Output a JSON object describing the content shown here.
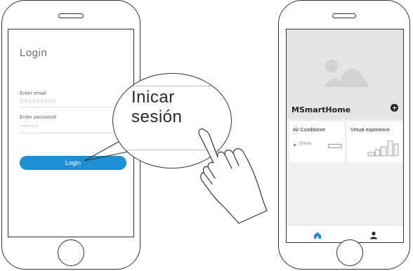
{
  "login_screen": {
    "title": "Login",
    "email_label": "Enter email",
    "email_value": "XXXXXXXXX",
    "password_label": "Enter password",
    "password_value": "••••••••",
    "login_button": "Login"
  },
  "magnifier": {
    "line1": "Inicar",
    "line2": "sesión"
  },
  "home_screen": {
    "app_name": "MSmartHome",
    "devices": [
      {
        "name": "Air Conditioner",
        "status": "Online"
      },
      {
        "name": "Virtual experience"
      }
    ],
    "tabs": [
      "home-icon",
      "user-icon"
    ]
  },
  "colors": {
    "accent": "#1e8fd6",
    "hero_bg": "#e4e4e4",
    "screen_bg": "#f0f0f0"
  }
}
